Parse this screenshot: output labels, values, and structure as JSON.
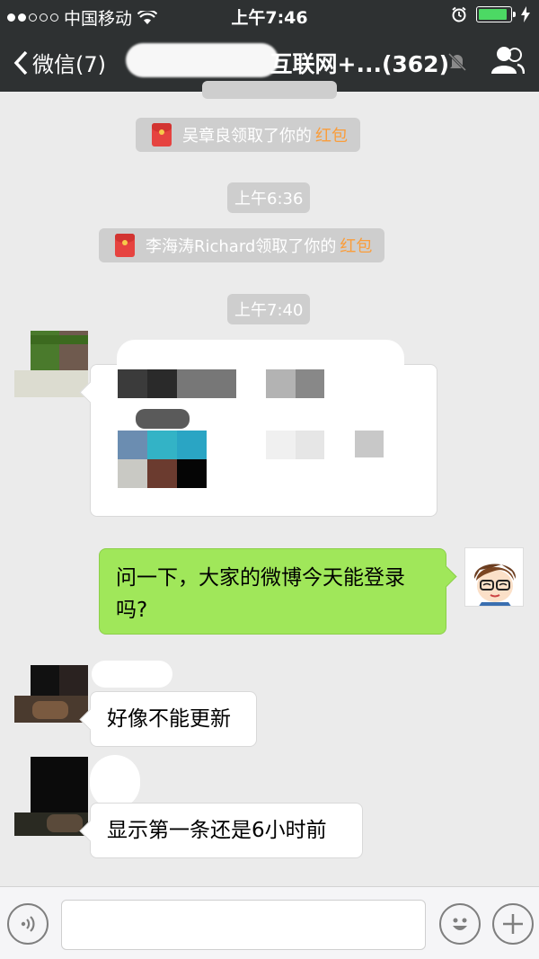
{
  "status_bar": {
    "carrier": "中国移动",
    "time": "上午7:46",
    "battery_level": 0.9
  },
  "nav": {
    "back_label": "微信(7)",
    "title": "互联网+...(362)"
  },
  "messages": {
    "m1_name": "吴章良领取了你的",
    "m1_link": "红包",
    "t1": "上午6:36",
    "m2_name": "李海涛Richard领取了你的",
    "m2_link": "红包",
    "t2": "上午7:40",
    "self_text": "问一下，大家的微博今天能登录吗?",
    "reply1": "好像不能更新",
    "reply2": "显示第一条还是6小时前"
  },
  "colors": {
    "nav_bg": "#2e3132",
    "chat_bg": "#ebebeb",
    "self_bubble": "#a0e75a",
    "red_packet_accent": "#fa9d3b"
  },
  "icons": {
    "back": "chevron-left-icon",
    "mute": "mute-bell-icon",
    "contacts": "group-contacts-icon",
    "voice": "voice-icon",
    "emoji": "emoji-icon",
    "add": "plus-icon"
  }
}
